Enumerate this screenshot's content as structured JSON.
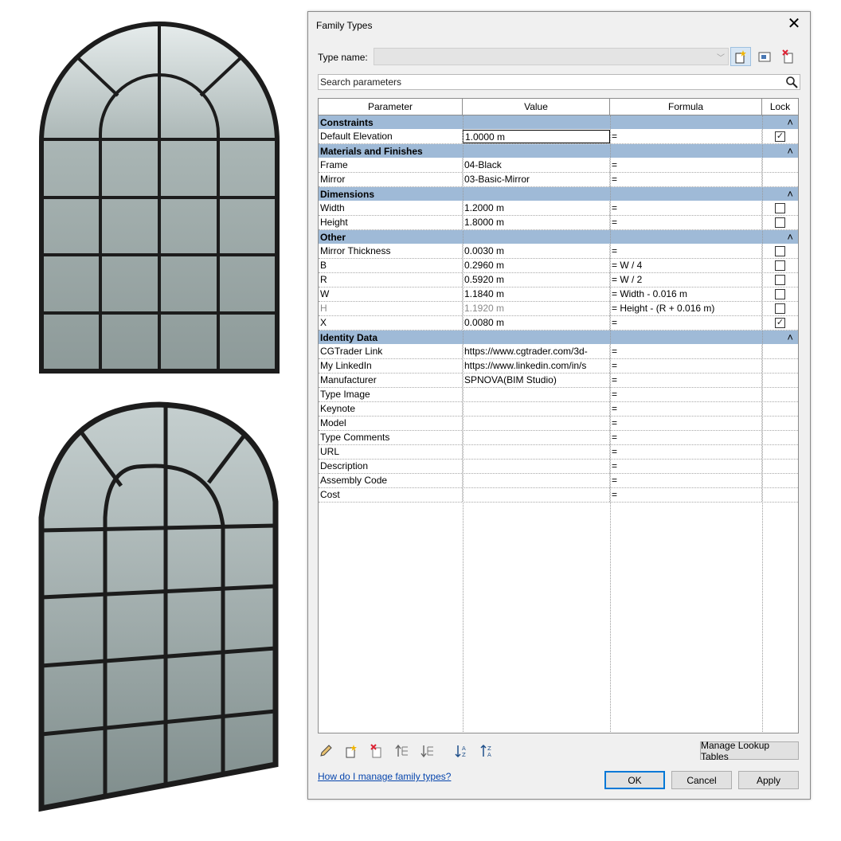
{
  "dialog": {
    "title": "Family Types",
    "close_icon": "close-icon",
    "type_name_label": "Type name:",
    "type_name_value": "",
    "search_placeholder": "Search parameters",
    "help_link": "How do I manage family types?",
    "buttons": {
      "manage_lookup": "Manage Lookup Tables",
      "ok": "OK",
      "cancel": "Cancel",
      "apply": "Apply"
    }
  },
  "grid": {
    "headers": [
      "Parameter",
      "Value",
      "Formula",
      "Lock"
    ],
    "groups": [
      {
        "name": "Constraints",
        "rows": [
          {
            "param": "Default Elevation",
            "value": "1.0000 m",
            "formula": "=",
            "lock": "checked",
            "editing": true
          }
        ]
      },
      {
        "name": "Materials and Finishes",
        "rows": [
          {
            "param": "Frame",
            "value": "04-Black",
            "formula": "=",
            "lock": "none"
          },
          {
            "param": "Mirror",
            "value": "03-Basic-Mirror",
            "formula": "=",
            "lock": "none"
          }
        ]
      },
      {
        "name": "Dimensions",
        "rows": [
          {
            "param": "Width",
            "value": "1.2000 m",
            "formula": "=",
            "lock": "unchecked"
          },
          {
            "param": "Height",
            "value": "1.8000 m",
            "formula": "=",
            "lock": "unchecked"
          }
        ]
      },
      {
        "name": "Other",
        "rows": [
          {
            "param": "Mirror Thickness",
            "value": "0.0030 m",
            "formula": "=",
            "lock": "unchecked"
          },
          {
            "param": "B",
            "value": "0.2960 m",
            "formula": "= W / 4",
            "lock": "unchecked"
          },
          {
            "param": "R",
            "value": "0.5920 m",
            "formula": "= W / 2",
            "lock": "unchecked"
          },
          {
            "param": "W",
            "value": "1.1840 m",
            "formula": "= Width - 0.016 m",
            "lock": "unchecked"
          },
          {
            "param": "H",
            "value": "1.1920 m",
            "formula": "= Height - (R + 0.016 m)",
            "lock": "unchecked",
            "grey": true
          },
          {
            "param": "X",
            "value": "0.0080 m",
            "formula": "=",
            "lock": "checked"
          }
        ]
      },
      {
        "name": "Identity Data",
        "rows": [
          {
            "param": "CGTrader Link",
            "value": "https://www.cgtrader.com/3d-",
            "formula": "=",
            "lock": "none"
          },
          {
            "param": "My LinkedIn",
            "value": "https://www.linkedin.com/in/s",
            "formula": "=",
            "lock": "none"
          },
          {
            "param": "Manufacturer",
            "value": "SPNOVA(BIM Studio)",
            "formula": "=",
            "lock": "none"
          },
          {
            "param": "Type Image",
            "value": "",
            "formula": "=",
            "lock": "none"
          },
          {
            "param": "Keynote",
            "value": "",
            "formula": "=",
            "lock": "none"
          },
          {
            "param": "Model",
            "value": "",
            "formula": "=",
            "lock": "none"
          },
          {
            "param": "Type Comments",
            "value": "",
            "formula": "=",
            "lock": "none"
          },
          {
            "param": "URL",
            "value": "",
            "formula": "=",
            "lock": "none"
          },
          {
            "param": "Description",
            "value": "",
            "formula": "=",
            "lock": "none"
          },
          {
            "param": "Assembly Code",
            "value": "",
            "formula": "=",
            "lock": "none"
          },
          {
            "param": "Cost",
            "value": "",
            "formula": "=",
            "lock": "none"
          }
        ]
      }
    ]
  },
  "colors": {
    "group_header": "#9fbad7",
    "dialog_bg": "#f0f0f0",
    "link": "#0645ad",
    "glass": "#9ea9a8",
    "frame": "#1c1c1c"
  },
  "icons": [
    "new-type-icon",
    "rename-type-icon",
    "delete-type-icon",
    "search-icon",
    "edit-parameter-icon",
    "new-parameter-icon",
    "delete-parameter-icon",
    "move-up-icon",
    "move-down-icon",
    "sort-ascending-icon",
    "sort-descending-icon",
    "collapse-group-icon"
  ]
}
